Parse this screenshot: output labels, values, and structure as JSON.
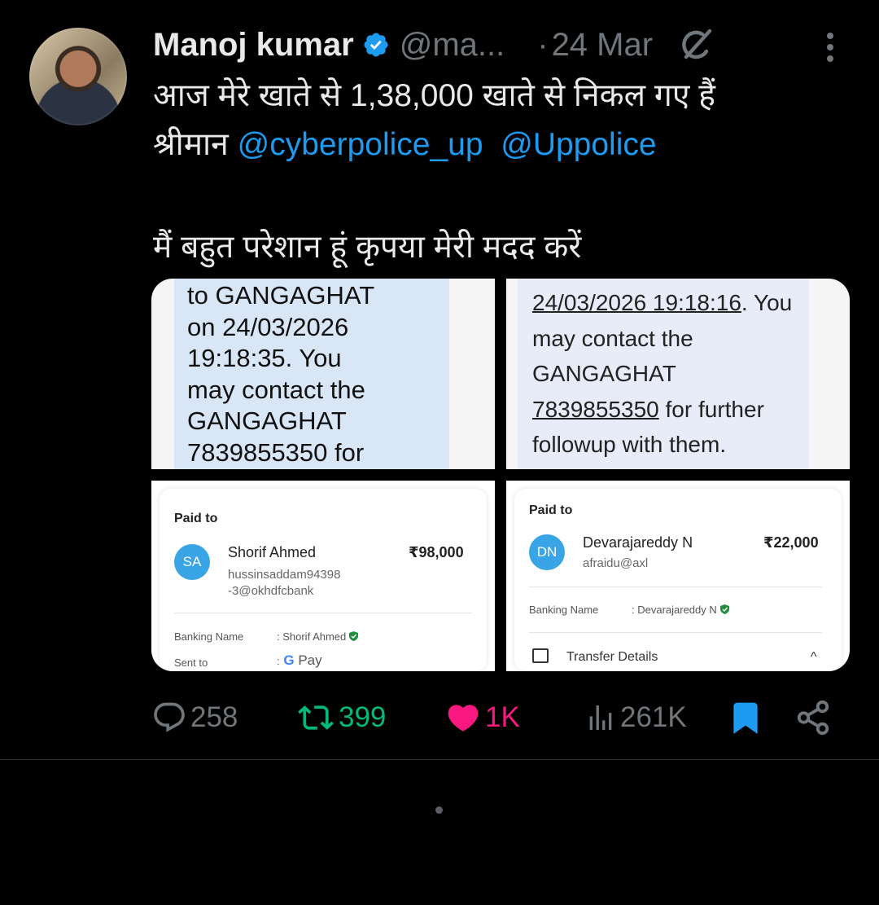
{
  "author": {
    "name": "Manoj kumar",
    "handle": "@ma...",
    "date_sep": "·",
    "date": "24 Mar"
  },
  "tweet": {
    "line1": "आज मेरे खाते से 1,38,000 खाते से निकल गए हैं",
    "line2_prefix": "श्रीमान",
    "mention1": "@cyberpolice_up",
    "mention2": "@Uppolice",
    "line3": "मैं बहुत परेशान हूं कृपया मेरी मदद करें"
  },
  "media": {
    "sms1": [
      "to GANGAGHAT",
      "on 24/03/2026",
      "19:18:35. You",
      "may contact the",
      "GANGAGHAT",
      "7839855350 for"
    ],
    "sms2": {
      "l1_u": "24/03/2026 19:18:16",
      "l1_rest": ". You",
      "l2": "may contact the",
      "l3": "GANGAGHAT",
      "l4_u": "7839855350",
      "l4_rest": " for further",
      "l5": "followup with them."
    },
    "pay1": {
      "paid_to": "Paid to",
      "initials": "SA",
      "name": "Shorif  Ahmed",
      "upi1": "hussinsaddam94398",
      "upi2": "-3@okhdfcbank",
      "amount": "₹98,000",
      "banking_label": "Banking Name",
      "banking_value": ": Shorif  Ahmed",
      "sent_label": "Sent to",
      "sent_colon": ":",
      "sent_g": "G",
      "sent_pay": " Pay"
    },
    "pay2": {
      "paid_to": "Paid to",
      "initials": "DN",
      "name": "Devarajareddy N",
      "upi": "afraidu@axl",
      "amount": "₹22,000",
      "banking_label": "Banking Name",
      "banking_value": ": Devarajareddy N",
      "transfer": "Transfer Details",
      "chevron": "^"
    }
  },
  "stats": {
    "replies": "258",
    "reposts": "399",
    "likes": "1K",
    "views": "261K"
  },
  "colors": {
    "accent": "#1d9bf0",
    "repost": "#00ba7c",
    "like": "#f91880",
    "muted": "#71767b"
  },
  "icons": [
    "verified-badge-icon",
    "grok-icon",
    "more-icon",
    "reply-icon",
    "repost-icon",
    "like-icon",
    "views-icon",
    "bookmark-icon",
    "share-icon"
  ]
}
